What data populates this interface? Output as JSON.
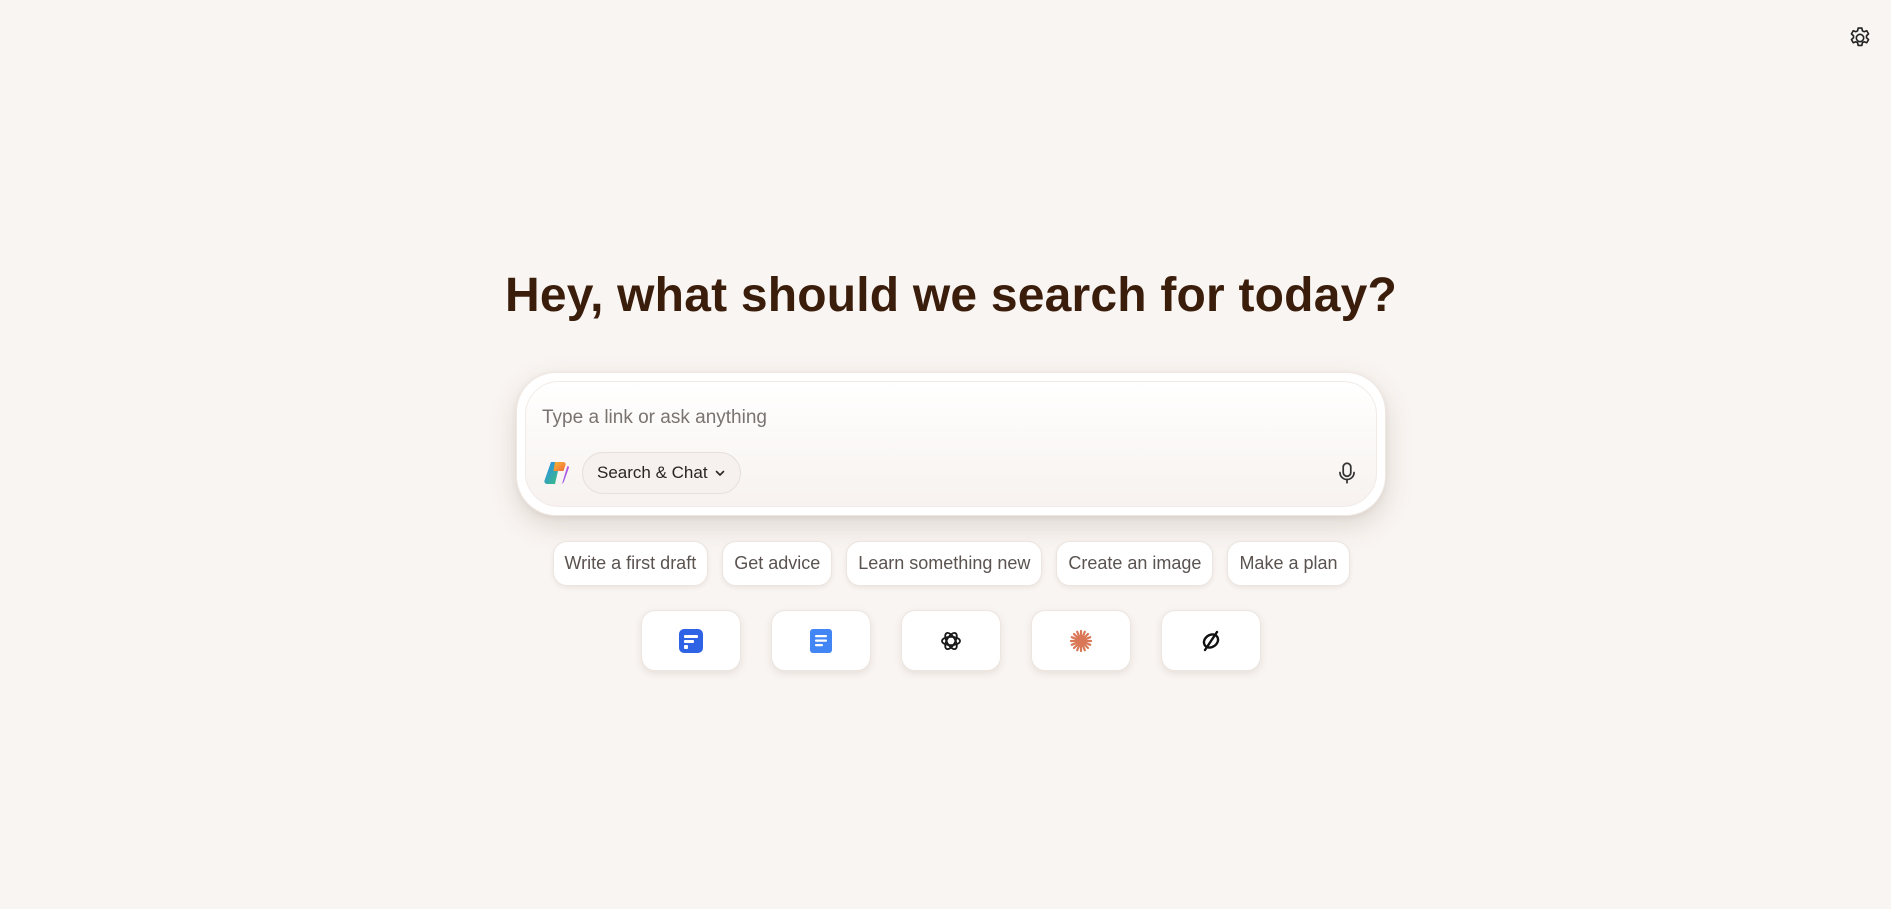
{
  "headline": "Hey, what should we search for today?",
  "composer": {
    "placeholder": "Type a link or ask anything",
    "mode_label": "Search & Chat"
  },
  "suggestions": [
    "Write a first draft",
    "Get advice",
    "Learn something new",
    "Create an image",
    "Make a plan"
  ],
  "apps": [
    "form-app-icon",
    "docs-app-icon",
    "openai-icon",
    "claude-icon",
    "perplexity-icon"
  ],
  "colors": {
    "background": "#f9f5f2",
    "headline": "#3a1d0b",
    "form_blue": "#2e63e6",
    "docs_blue": "#4285f4",
    "claude_orange": "#d97757"
  }
}
